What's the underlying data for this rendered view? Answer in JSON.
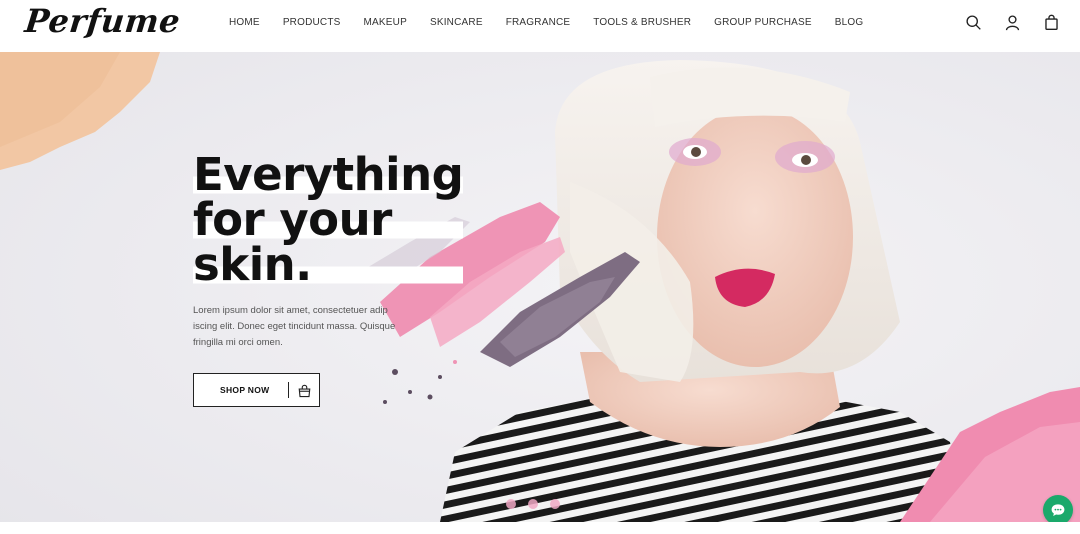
{
  "header": {
    "logo": "Perfume",
    "nav": [
      "HOME",
      "PRODUCTS",
      "MAKEUP",
      "SKINCARE",
      "FRAGRANCE",
      "TOOLS & BRUSHER",
      "GROUP PURCHASE",
      "BLOG"
    ],
    "icons": [
      "search-icon",
      "user-icon",
      "shopping-bag-icon"
    ]
  },
  "hero": {
    "headline": [
      "Everything",
      "for your",
      "skin."
    ],
    "subtext": "Lorem ipsum dolor sit amet, consectetuer adip iscing elit. Donec eget tincidunt massa. Quisque fringilla mi orci omen.",
    "cta_label": "SHOP NOW",
    "cta_icon": "shopping-bag-icon",
    "slider_dots": 3,
    "chat_icon": "chat-bubble-icon"
  },
  "colors": {
    "hero_bg": "#ecebef",
    "pink_accent": "#f08cb0",
    "chat_green": "#1aa96b",
    "text_dark": "#111111"
  }
}
